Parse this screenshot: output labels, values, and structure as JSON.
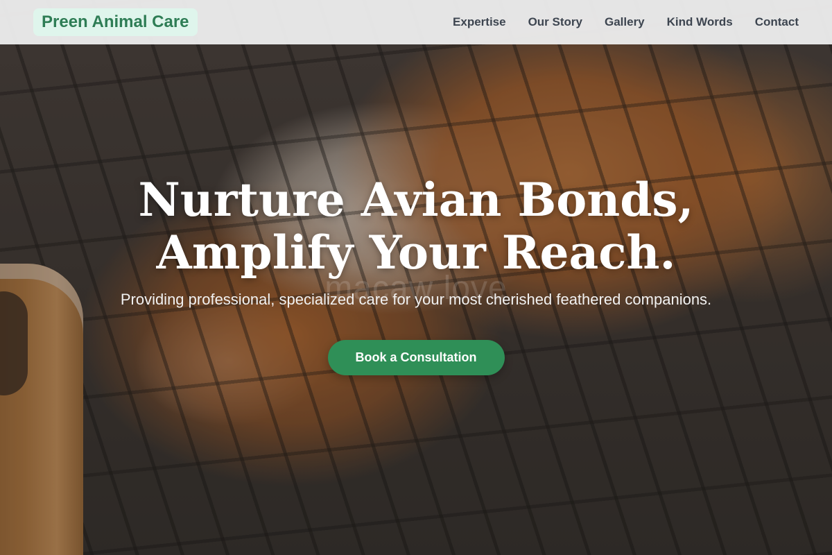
{
  "brand": {
    "name": "Preen Animal Care"
  },
  "nav": {
    "links": [
      "Expertise",
      "Our Story",
      "Gallery",
      "Kind Words",
      "Contact"
    ]
  },
  "hero": {
    "title_line1": "Nurture Avian Bonds,",
    "title_line2": "Amplify Your Reach.",
    "watermark": "macaw love",
    "subtitle": "Providing professional, specialized care for your most cherished feathered companions.",
    "cta_label": "Book a Consultation",
    "background_image": "guinea-pig-on-wire-grid"
  },
  "colors": {
    "accent": "#2f8f57",
    "brand_text": "#2e7d55",
    "brand_bg": "#dff5ec",
    "nav_text": "#3d4550"
  }
}
